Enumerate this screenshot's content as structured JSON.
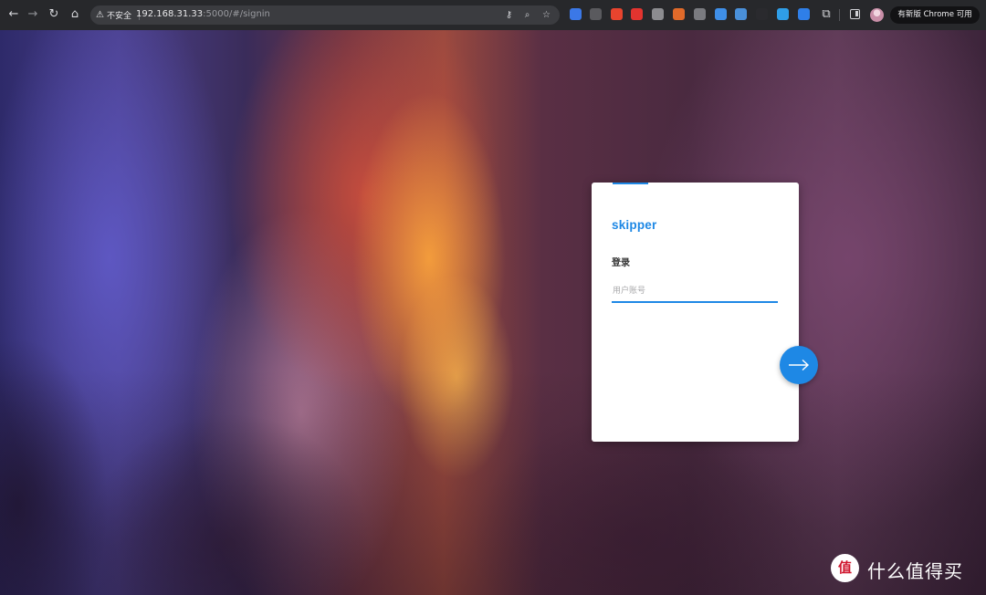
{
  "browser": {
    "security_label": "不安全",
    "url_host": "192.168.31.33",
    "url_rest": ":5000/#/signin",
    "update_label": "有新版 Chrome 可用",
    "extension_colors": [
      "#3b78e7",
      "#5a5a5e",
      "#e8442e",
      "#e3342f",
      "#8c8c90",
      "#e06a2a",
      "#7a7b80",
      "#3f8fe8",
      "#4a90d9",
      "#2a2a2e",
      "#2f9ee8",
      "#2f7fe8"
    ]
  },
  "login": {
    "brand": "skipper",
    "title": "登录",
    "username_placeholder": "用户账号",
    "accent_color": "#1e88e5"
  },
  "watermark": {
    "badge": "值",
    "text": "什么值得买"
  }
}
